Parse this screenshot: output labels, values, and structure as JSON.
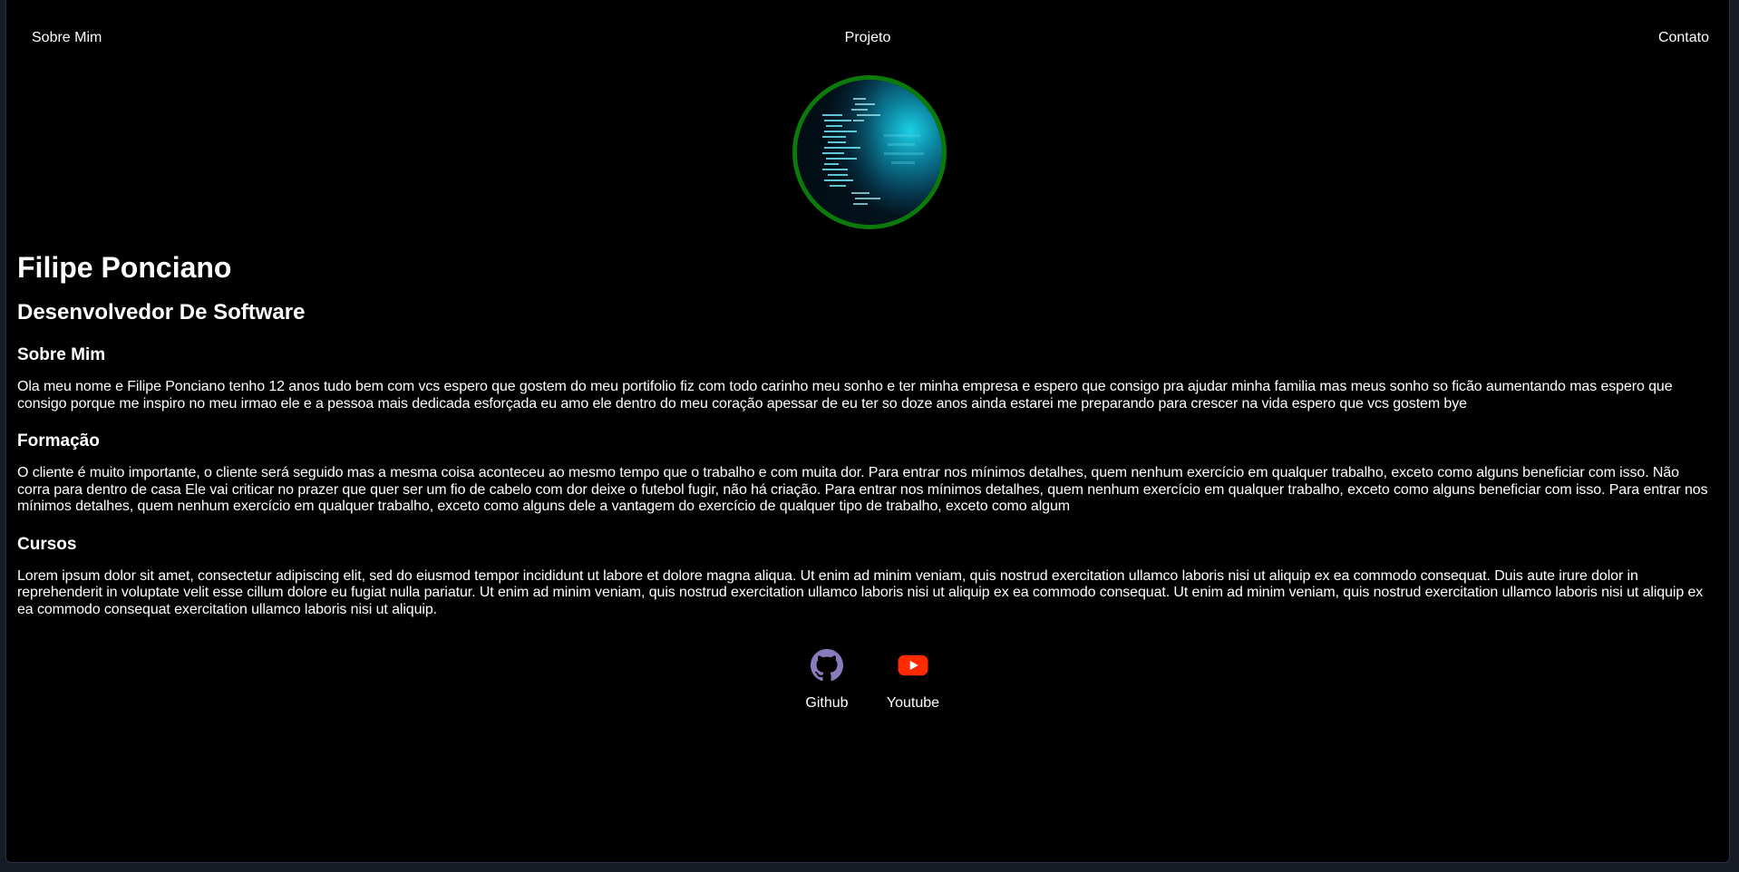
{
  "nav": {
    "items": [
      {
        "label": "Sobre Mim"
      },
      {
        "label": "Projeto"
      },
      {
        "label": "Contato"
      }
    ]
  },
  "profile": {
    "name": "Filipe Ponciano",
    "role": "Desenvolvedor De Software",
    "avatar_ring_color": "#0b7a0b"
  },
  "sections": [
    {
      "title": "Sobre Mim",
      "text": "Ola meu nome e Filipe Ponciano tenho 12 anos tudo bem com vcs espero que gostem do meu portifolio fiz com todo carinho meu sonho e ter minha empresa e espero que consigo pra ajudar minha familia mas meus sonho so ficão aumentando mas espero que consigo porque me inspiro no meu irmao ele e a pessoa mais dedicada esforçada eu amo ele dentro do meu coração apessar de eu ter so doze anos ainda estarei me preparando para crescer na vida espero que vcs gostem bye"
    },
    {
      "title": "Formação",
      "text": "O cliente é muito importante, o cliente será seguido mas a mesma coisa aconteceu ao mesmo tempo que o trabalho e com muita dor. Para entrar nos mínimos detalhes, quem nenhum exercício em qualquer trabalho, exceto como alguns beneficiar com isso. Não corra para dentro de casa Ele vai criticar no prazer que quer ser um fio de cabelo com dor deixe o futebol fugir, não há criação. Para entrar nos mínimos detalhes, quem nenhum exercício em qualquer trabalho, exceto como alguns beneficiar com isso. Para entrar nos mínimos detalhes, quem nenhum exercício em qualquer trabalho, exceto como alguns dele a vantagem do exercício de qualquer tipo de trabalho, exceto como algum"
    },
    {
      "title": "Cursos",
      "text": "Lorem ipsum dolor sit amet, consectetur adipiscing elit, sed do eiusmod tempor incididunt ut labore et dolore magna aliqua. Ut enim ad minim veniam, quis nostrud exercitation ullamco laboris nisi ut aliquip ex ea commodo consequat. Duis aute irure dolor in reprehenderit in voluptate velit esse cillum dolore eu fugiat nulla pariatur. Ut enim ad minim veniam, quis nostrud exercitation ullamco laboris nisi ut aliquip ex ea commodo consequat. Ut enim ad minim veniam, quis nostrud exercitation ullamco laboris nisi ut aliquip ex ea commodo consequat exercitation ullamco laboris nisi ut aliquip."
    }
  ],
  "social": [
    {
      "label": "Github",
      "icon": "github-icon",
      "color": "#8a7bbd"
    },
    {
      "label": "Youtube",
      "icon": "youtube-icon",
      "color": "#ff2a00"
    }
  ]
}
